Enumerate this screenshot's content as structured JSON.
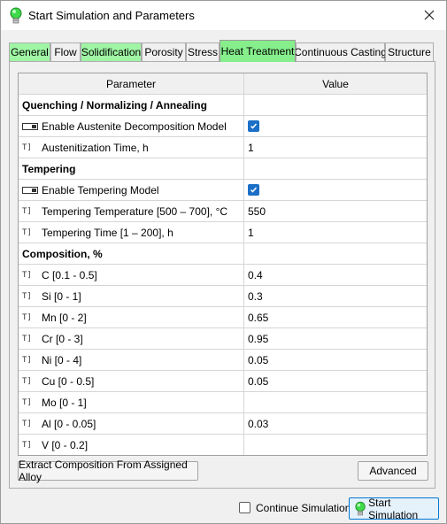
{
  "window": {
    "title": "Start Simulation and Parameters",
    "icon": "green-bulb-icon",
    "close_icon": "close-icon"
  },
  "tabs": [
    {
      "label": "General",
      "state": "green"
    },
    {
      "label": "Flow",
      "state": "normal"
    },
    {
      "label": "Solidification",
      "state": "green"
    },
    {
      "label": "Porosity",
      "state": "normal"
    },
    {
      "label": "Stress",
      "state": "normal"
    },
    {
      "label": "Heat Treatment",
      "state": "active"
    },
    {
      "label": "Continuous Casting",
      "state": "normal"
    },
    {
      "label": "Structure",
      "state": "normal"
    }
  ],
  "grid": {
    "headers": {
      "parameter": "Parameter",
      "value": "Value"
    },
    "rows": [
      {
        "type": "section",
        "label": "Quenching / Normalizing / Annealing",
        "value": ""
      },
      {
        "type": "checkbox",
        "label": "Enable Austenite Decomposition Model",
        "checked": true
      },
      {
        "type": "text",
        "label": "Austenitization Time, h",
        "value": "1"
      },
      {
        "type": "section",
        "label": "Tempering",
        "value": ""
      },
      {
        "type": "checkbox",
        "label": "Enable Tempering Model",
        "checked": true
      },
      {
        "type": "text",
        "label": "Tempering Temperature [500 – 700], °C",
        "value": "550"
      },
      {
        "type": "text",
        "label": "Tempering Time [1 – 200], h",
        "value": "1"
      },
      {
        "type": "section",
        "label": "Composition, %",
        "value": ""
      },
      {
        "type": "text",
        "label": "C [0.1 - 0.5]",
        "value": "0.4"
      },
      {
        "type": "text",
        "label": "Si [0 - 1]",
        "value": "0.3"
      },
      {
        "type": "text",
        "label": "Mn [0 - 2]",
        "value": "0.65"
      },
      {
        "type": "text",
        "label": "Cr [0 - 3]",
        "value": "0.95"
      },
      {
        "type": "text",
        "label": "Ni [0 - 4]",
        "value": "0.05"
      },
      {
        "type": "text",
        "label": "Cu [0 - 0.5]",
        "value": "0.05"
      },
      {
        "type": "text",
        "label": "Mo [0 - 1]",
        "value": ""
      },
      {
        "type": "text",
        "label": "Al [0 - 0.05]",
        "value": "0.03"
      },
      {
        "type": "text",
        "label": "V [0 - 0.2]",
        "value": ""
      }
    ]
  },
  "buttons": {
    "extract": "Extract Composition From Assigned Alloy",
    "advanced": "Advanced",
    "start": "Start Simulation"
  },
  "footer": {
    "continue_label": "Continue Simulation",
    "continue_checked": false
  },
  "icons": {
    "text_field": "T]",
    "checkbox_field": "checkbox-field-icon"
  },
  "colors": {
    "active_tab": "#86ef8c",
    "green_tab": "#9ff5a4",
    "checkbox": "#1b6fc6",
    "start_button_border": "#0078d4"
  }
}
